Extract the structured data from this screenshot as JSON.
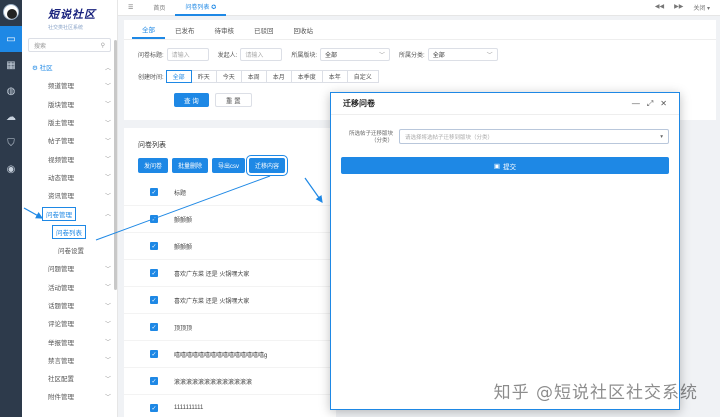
{
  "rail": {
    "icons": [
      "monitor-icon",
      "grid-icon",
      "globe-icon",
      "cloud-icon",
      "shield-icon",
      "eye-icon"
    ]
  },
  "sidebar": {
    "title": "短说社区",
    "subtitle": "社交类社区系统",
    "search_placeholder": "搜索",
    "group_label": "社区",
    "items": [
      {
        "label": "频道管理"
      },
      {
        "label": "版块管理"
      },
      {
        "label": "版主管理"
      },
      {
        "label": "帖子管理"
      },
      {
        "label": "视频管理"
      },
      {
        "label": "动态管理"
      },
      {
        "label": "资讯管理"
      },
      {
        "label": "问卷管理"
      }
    ],
    "sub_items": [
      {
        "label": "问卷列表"
      },
      {
        "label": "问卷设置"
      }
    ],
    "items2": [
      {
        "label": "问题管理"
      },
      {
        "label": "活动管理"
      },
      {
        "label": "话题管理"
      },
      {
        "label": "评论管理"
      },
      {
        "label": "举报管理"
      },
      {
        "label": "禁言管理"
      },
      {
        "label": "社区配置"
      },
      {
        "label": "附件管理"
      }
    ]
  },
  "topbar": {
    "tabs": [
      "首页",
      "问卷列表 ✪"
    ],
    "right": [
      "◀◀",
      "▶▶",
      "关闭 ▾"
    ]
  },
  "status_tabs": [
    "全部",
    "已发布",
    "待审核",
    "已驳回",
    "回收站"
  ],
  "filters": {
    "title_label": "问卷标题:",
    "title_placeholder": "请输入",
    "author_label": "发起人:",
    "author_placeholder": "请输入",
    "board_label": "所属版块:",
    "board_value": "全部",
    "category_label": "所属分类:",
    "category_value": "全部",
    "time_label": "创建时间:",
    "time_options": [
      "全部",
      "昨天",
      "今天",
      "本周",
      "本月",
      "本季度",
      "本年",
      "自定义"
    ],
    "time_selected": "全部",
    "search_button": "查 询",
    "reset_button": "重 置"
  },
  "list": {
    "title": "问卷列表",
    "buttons": [
      "发问卷",
      "批量删除",
      "导出csv",
      "迁移内容"
    ],
    "header": "标题",
    "rows": [
      "颤颤颤",
      "颤颤颤",
      "喜欢广东菜 还是 火锅嘿大家",
      "喜欢广东菜 还是 火锅嘿大家",
      "顶顶顶",
      "嘻嘻嘻嘻嘻嘻嘻嘻嘻嘻嘻嘻嘻嘻嘻g",
      "滚滚滚滚滚滚滚滚滚滚滚滚滚",
      "1111111111"
    ]
  },
  "modal": {
    "title": "迁移问卷",
    "field_label": "所选帖子迁移版块（分类）",
    "field_placeholder": "请选择将选帖子迁移到版块（分类）",
    "submit_label": "提交",
    "controls": [
      "—",
      "⤢",
      "✕"
    ]
  },
  "watermark": "知乎 @短说社区社交系统",
  "colors": {
    "accent": "#1e88e5",
    "rail_bg": "#2d3a4b"
  }
}
